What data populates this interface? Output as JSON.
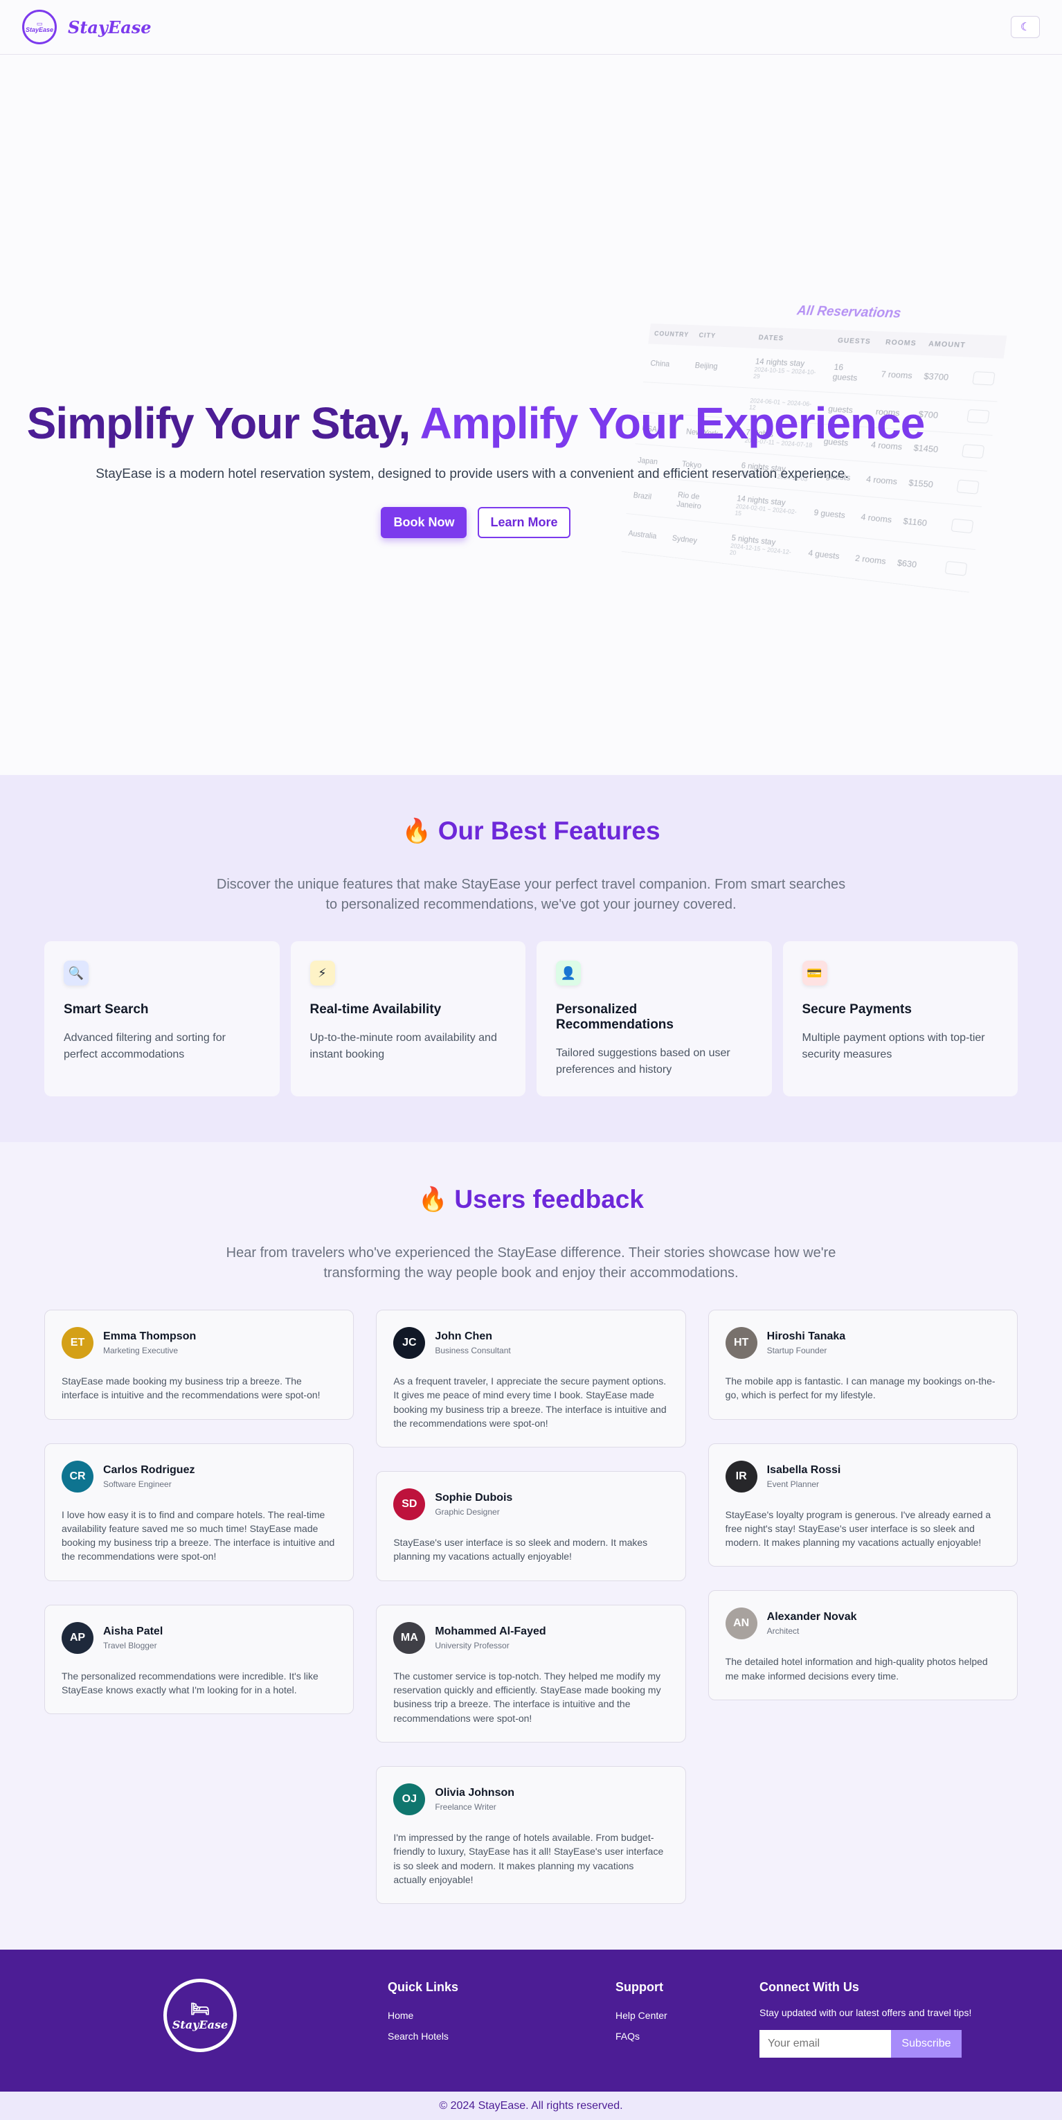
{
  "header": {
    "logo_text": "StayEase",
    "brand_name": "StayEase",
    "theme_toggle_icon": "☾"
  },
  "hero": {
    "title_part1": "Simplify Your Stay, ",
    "title_part2": "Amplify Your Experience",
    "subtitle": "StayEase is a modern hotel reservation system, designed to provide users with a convenient and efficient reservation experience.",
    "book_now": "Book Now",
    "learn_more": "Learn More",
    "table": {
      "title": "All Reservations",
      "columns": [
        "COUNTRY",
        "CITY",
        "DATES",
        "GUESTS",
        "ROOMS",
        "AMOUNT"
      ],
      "rows": [
        {
          "country": "China",
          "city": "Beijing",
          "dates": "14 nights stay",
          "dates_sub": "2024-10-15 ~ 2024-10-29",
          "guests": "16 guests",
          "rooms": "7 rooms",
          "amount": "$3700"
        },
        {
          "country": "",
          "city": "",
          "dates": "",
          "dates_sub": "2024-06-01 ~ 2024-06-12",
          "guests": "guests",
          "rooms": "rooms",
          "amount": "$700"
        },
        {
          "country": "USA",
          "city": "New York",
          "dates": "7 nights",
          "dates_sub": "2024-07-11 ~ 2024-07-18",
          "guests": "guests",
          "rooms": "4 rooms",
          "amount": "$1450"
        },
        {
          "country": "Japan",
          "city": "Tokyo",
          "dates": "6 nights stay",
          "dates_sub": "2024-10-28 ~ 2024-11-03",
          "guests": "8 guests",
          "rooms": "4 rooms",
          "amount": "$1550"
        },
        {
          "country": "Brazil",
          "city": "Rio de Janeiro",
          "dates": "14 nights stay",
          "dates_sub": "2024-02-01 ~ 2024-02-15",
          "guests": "9 guests",
          "rooms": "4 rooms",
          "amount": "$1160"
        },
        {
          "country": "Australia",
          "city": "Sydney",
          "dates": "5 nights stay",
          "dates_sub": "2024-12-15 ~ 2024-12-20",
          "guests": "4 guests",
          "rooms": "2 rooms",
          "amount": "$630"
        }
      ]
    }
  },
  "features": {
    "title": "Our Best Features",
    "subtitle": "Discover the unique features that make StayEase your perfect travel companion. From smart searches to personalized recommendations, we've got your journey covered.",
    "items": [
      {
        "icon": "🔍",
        "icon_name": "magnifier-icon",
        "bg": "#e0e7ff",
        "title": "Smart Search",
        "desc": "Advanced filtering and sorting for perfect accommodations"
      },
      {
        "icon": "⚡",
        "icon_name": "lightning-icon",
        "bg": "#fef3c7",
        "title": "Real-time Availability",
        "desc": "Up-to-the-minute room availability and instant booking"
      },
      {
        "icon": "👤",
        "icon_name": "user-check-icon",
        "bg": "#dcfce7",
        "title": "Personalized Recommendations",
        "desc": "Tailored suggestions based on user preferences and history"
      },
      {
        "icon": "💳",
        "icon_name": "credit-card-icon",
        "bg": "#fee2e2",
        "title": "Secure Payments",
        "desc": "Multiple payment options with top-tier security measures"
      }
    ]
  },
  "feedback": {
    "title": "Users feedback",
    "subtitle": "Hear from travelers who've experienced the StayEase difference. Their stories showcase how we're transforming the way people book and enjoy their accommodations.",
    "columns": [
      [
        {
          "name": "Emma Thompson",
          "role": "Marketing Executive",
          "initials": "ET",
          "color": "#d4a017",
          "text": "StayEase made booking my business trip a breeze. The interface is intuitive and the recommendations were spot-on!"
        },
        {
          "name": "Carlos Rodriguez",
          "role": "Software Engineer",
          "initials": "CR",
          "color": "#0e7490",
          "text": "I love how easy it is to find and compare hotels. The real-time availability feature saved me so much time! StayEase made booking my business trip a breeze. The interface is intuitive and the recommendations were spot-on!"
        },
        {
          "name": "Aisha Patel",
          "role": "Travel Blogger",
          "initials": "AP",
          "color": "#1e293b",
          "text": "The personalized recommendations were incredible. It's like StayEase knows exactly what I'm looking for in a hotel."
        }
      ],
      [
        {
          "name": "John Chen",
          "role": "Business Consultant",
          "initials": "JC",
          "color": "#111827",
          "text": "As a frequent traveler, I appreciate the secure payment options. It gives me peace of mind every time I book. StayEase made booking my business trip a breeze. The interface is intuitive and the recommendations were spot-on!"
        },
        {
          "name": "Sophie Dubois",
          "role": "Graphic Designer",
          "initials": "SD",
          "color": "#be123c",
          "text": "StayEase's user interface is so sleek and modern. It makes planning my vacations actually enjoyable!"
        },
        {
          "name": "Mohammed Al-Fayed",
          "role": "University Professor",
          "initials": "MA",
          "color": "#3f3f46",
          "text": "The customer service is top-notch. They helped me modify my reservation quickly and efficiently. StayEase made booking my business trip a breeze. The interface is intuitive and the recommendations were spot-on!"
        },
        {
          "name": "Olivia Johnson",
          "role": "Freelance Writer",
          "initials": "OJ",
          "color": "#0f766e",
          "text": "I'm impressed by the range of hotels available. From budget-friendly to luxury, StayEase has it all! StayEase's user interface is so sleek and modern. It makes planning my vacations actually enjoyable!"
        }
      ],
      [
        {
          "name": "Hiroshi Tanaka",
          "role": "Startup Founder",
          "initials": "HT",
          "color": "#78716c",
          "text": "The mobile app is fantastic. I can manage my bookings on-the-go, which is perfect for my lifestyle."
        },
        {
          "name": "Isabella Rossi",
          "role": "Event Planner",
          "initials": "IR",
          "color": "#27272a",
          "text": "StayEase's loyalty program is generous. I've already earned a free night's stay! StayEase's user interface is so sleek and modern. It makes planning my vacations actually enjoyable!"
        },
        {
          "name": "Alexander Novak",
          "role": "Architect",
          "initials": "AN",
          "color": "#a8a29e",
          "text": "The detailed hotel information and high-quality photos helped me make informed decisions every time."
        }
      ]
    ]
  },
  "footer": {
    "logo_text": "StayEase",
    "quick_links": {
      "title": "Quick Links",
      "links": [
        "Home",
        "Search Hotels"
      ]
    },
    "support": {
      "title": "Support",
      "links": [
        "Help Center",
        "FAQs"
      ]
    },
    "connect": {
      "title": "Connect With Us",
      "text": "Stay updated with our latest offers and travel tips!",
      "email_placeholder": "Your email",
      "subscribe": "Subscribe"
    },
    "copyright": "© 2024 StayEase. All rights reserved."
  }
}
